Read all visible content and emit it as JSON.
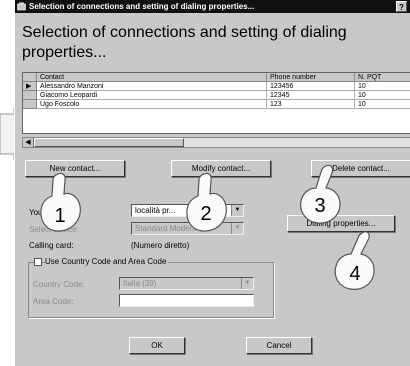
{
  "window": {
    "title": "Selection of connections and setting of dialing properties...",
    "help_glyph": "?",
    "heading": "Selection of connections and setting of dialing properties..."
  },
  "table": {
    "columns": [
      "Contact",
      "Phone number",
      "N. PQT"
    ],
    "rows": [
      {
        "contact": "Alessandro Manzoni",
        "phone": "123456",
        "pqt": "10",
        "selected": true
      },
      {
        "contact": "Giacomo Leopardi",
        "phone": "12345",
        "pqt": "10",
        "selected": false
      },
      {
        "contact": "Ugo Foscolo",
        "phone": "123",
        "pqt": "10",
        "selected": false
      }
    ],
    "row_marker": "▶"
  },
  "buttons": {
    "new_contact": "New contact...",
    "modify_contact": "Modify contact...",
    "delete_contact": "Delete contact...",
    "dialing_properties": "Dialing properties...",
    "ok": "OK",
    "cancel": "Cancel"
  },
  "form": {
    "location_label": "Your location:",
    "location_value": "località pr...",
    "device_label": "Select device:",
    "device_value": "Standard Modem",
    "calling_card_label": "Calling card:",
    "calling_card_value": "(Numero diretto)",
    "use_country_code_label": "Use Country Code and Area Code",
    "use_country_code_checked": false,
    "country_code_label": "Country Code:",
    "country_code_value": "Italia (39)",
    "area_code_label": "Area Code:",
    "area_code_value": ""
  },
  "callouts": [
    "1",
    "2",
    "3",
    "4"
  ],
  "colors": {
    "dialog_bg": "#c8c8c8",
    "titlebar_bg": "#111111",
    "disabled_text": "#8a8a8a"
  }
}
